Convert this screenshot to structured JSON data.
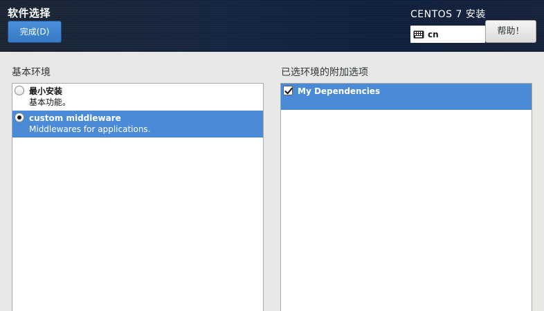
{
  "header": {
    "page_title": "软件选择",
    "done_label": "完成(D)",
    "product_title": "CENTOS 7 安装",
    "keyboard_layout": "cn",
    "help_label": "帮助！",
    "accent_color": "#4a8ad6",
    "background_color": "#15243f"
  },
  "base_environment": {
    "heading": "基本环境",
    "items": [
      {
        "title": "最小安装",
        "description": "基本功能。",
        "selected": false
      },
      {
        "title": "custom middleware",
        "description": "Middlewares for applications.",
        "selected": true
      }
    ]
  },
  "addons": {
    "heading": "已选环境的附加选项",
    "items": [
      {
        "title": "My Dependencies",
        "checked": true,
        "highlighted": true
      }
    ]
  },
  "icons": {
    "keyboard": "keyboard-icon",
    "checkmark": "checkmark-icon"
  }
}
